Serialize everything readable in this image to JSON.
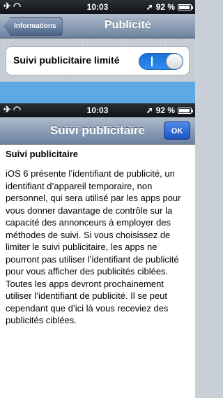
{
  "status_bar": {
    "time": "10:03",
    "battery_text": "92 %",
    "battery_level": 0.92
  },
  "settings_screen": {
    "back_label": "Informations",
    "title": "Publicité",
    "setting_label": "Suivi publicitaire limité",
    "toggle_state": "on",
    "toggle_text": "I"
  },
  "sheet": {
    "title": "Suivi publicitaire",
    "ok_label": "OK",
    "heading": "Suivi publicitaire",
    "body": "iOS 6 présente l’identifiant de publicité, un identifiant d’appareil temporaire, non personnel, qui sera utilisé par les apps pour vous donner davantage de contrôle sur la capacité des annonceurs à employer des méthodes de suivi. Si vous choisissez de limiter le suivi publicitaire, les apps ne pourront pas utiliser l’identifiant de publicité pour vous afficher des publicités ciblées. Toutes les apps devront prochainement utiliser l’identifiant de publicité. Il se peut cependant que d’ici là vous receviez des publicités ciblées."
  },
  "colors": {
    "toggle_on": "#2f8cf2",
    "ok_button": "#1a55c2",
    "nav_bar": "#6d83a1"
  },
  "icons": [
    "airplane-icon",
    "wifi-icon",
    "location-icon",
    "battery-icon"
  ]
}
